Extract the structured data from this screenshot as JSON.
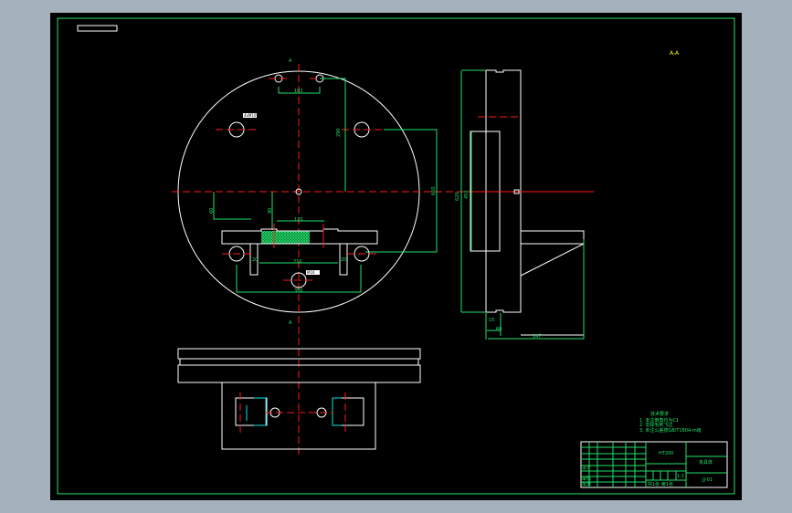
{
  "drawing": {
    "section_marks": [
      "A",
      "A"
    ],
    "note_top_right": "A-A",
    "dimensions": {
      "top_holes": "102",
      "hole_callout_left": "4xM10",
      "hole_callout_bottom": "M16",
      "vertical_left": "90",
      "vertical_left2": "60",
      "vertical_right": "290",
      "diameter": "660",
      "slot_width": "120",
      "inner_span": "210",
      "outer_span": "350",
      "pad_left": "20",
      "pad_right": "20",
      "side_height": "620",
      "side_inner": "450",
      "side_base": "60",
      "side_total": "247",
      "side_small": "15"
    },
    "tech_requirements": {
      "title": "技术要求",
      "items": [
        "1. 未注倒角均为C1",
        "2. 去除毛刺飞边",
        "3. 未注公差按GB/T1804-m级"
      ]
    },
    "title_block": {
      "part_name": "夹具体",
      "material": "HT200",
      "scale": "1:1",
      "sheet": "共1张 第1张",
      "designer": "设计",
      "checker": "审核",
      "approve": "批准",
      "drawing_no": "JJ-01"
    }
  },
  "colors": {
    "background": "#000000",
    "frame": "#22e06a",
    "outline": "#ffffff",
    "centerline": "#ff1a1a",
    "hatch": "#22e06a",
    "hidden": "#00e5e5"
  }
}
